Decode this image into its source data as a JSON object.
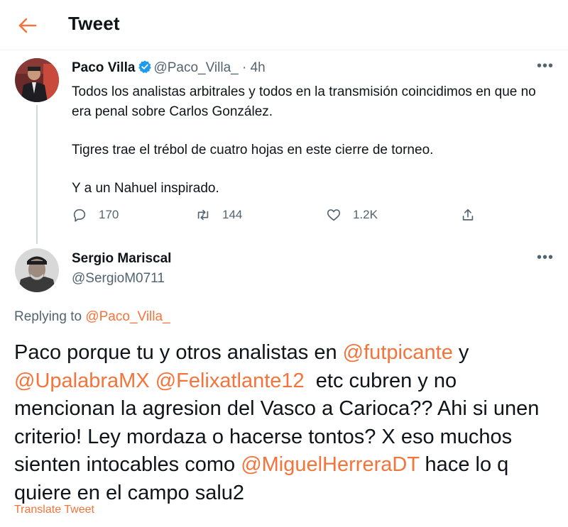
{
  "colors": {
    "accent": "#f4743b",
    "muted": "#536471",
    "text": "#0f1419",
    "verified": "#1d9bf0"
  },
  "header": {
    "title": "Tweet",
    "back_icon": "arrow-left-icon"
  },
  "tweet": {
    "author_name": "Paco Villa",
    "verified_icon": "verified-badge-icon",
    "handle_time": "@Paco_Villa_ · 4h",
    "more_icon": "more-dots-icon",
    "paragraphs": [
      "Todos los analistas arbitrales y todos en la transmisión coincidimos en que no era penal sobre Carlos González.",
      "Tigres trae el trébol de cuatro hojas en este cierre de torneo.",
      "Y a un Nahuel inspirado."
    ],
    "actions": {
      "reply_count": "170",
      "retweet_count": "144",
      "like_count": "1.2K"
    }
  },
  "reply": {
    "author_name": "Sergio Mariscal",
    "handle": "@SergioM0711",
    "replying_prefix": "Replying to ",
    "replying_to": "@Paco_Villa_",
    "text_parts": {
      "p1": "Paco porque tu y otros analistas en ",
      "m1": "@futpicante",
      "p2": " y ",
      "m2": "@UpalabraMX",
      "p3": " ",
      "m3": "@Felixatlante12",
      "p4": "  etc cubren y no mencionan la agresion del Vasco a Carioca?? Ahi si unen criterio! Ley mordaza o hacerse tontos? X eso muchos sienten intocables como ",
      "m4": "@MiguelHerreraDT",
      "p5": " hace lo q quiere en el campo salu2"
    },
    "translate_label": "Translate Tweet"
  }
}
